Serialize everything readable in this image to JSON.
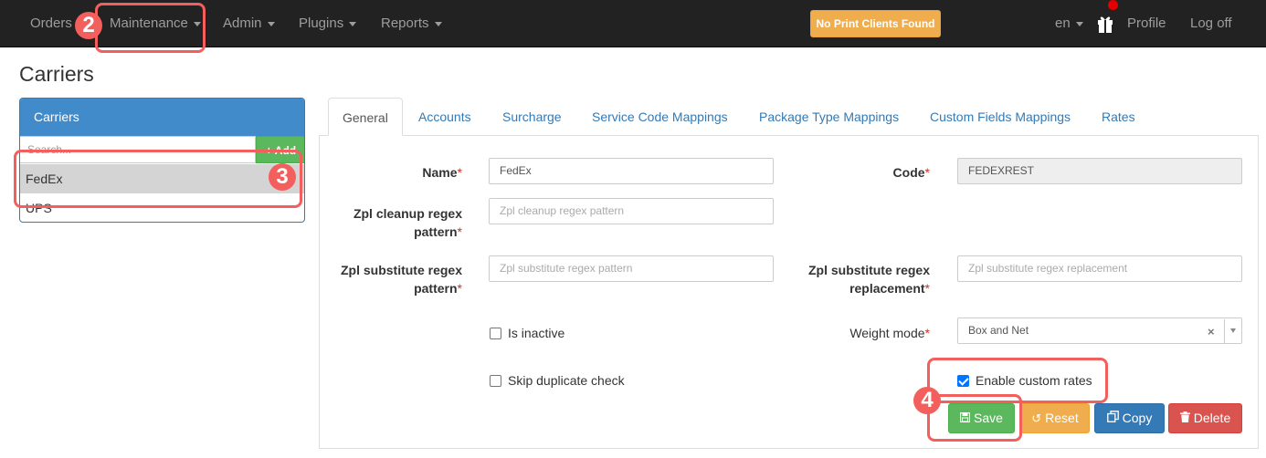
{
  "navbar": {
    "items": [
      {
        "label": "Orders",
        "dropdown": false
      },
      {
        "label": "Maintenance",
        "dropdown": true
      },
      {
        "label": "Admin",
        "dropdown": true
      },
      {
        "label": "Plugins",
        "dropdown": true
      },
      {
        "label": "Reports",
        "dropdown": true
      }
    ],
    "print_alert": "No Print Clients Found",
    "language": "en",
    "profile": "Profile",
    "logoff": "Log off"
  },
  "page": {
    "title": "Carriers"
  },
  "carriers_panel": {
    "header": "Carriers",
    "search_placeholder": "Search...",
    "add_label": "Add",
    "items": [
      {
        "name": "FedEx",
        "selected": true
      },
      {
        "name": "UPS",
        "selected": false
      }
    ]
  },
  "tabs": [
    {
      "label": "General",
      "active": true
    },
    {
      "label": "Accounts",
      "active": false
    },
    {
      "label": "Surcharge",
      "active": false
    },
    {
      "label": "Service Code Mappings",
      "active": false
    },
    {
      "label": "Package Type Mappings",
      "active": false
    },
    {
      "label": "Custom Fields Mappings",
      "active": false
    },
    {
      "label": "Rates",
      "active": false
    }
  ],
  "form": {
    "name": {
      "label": "Name",
      "value": "FedEx"
    },
    "code": {
      "label": "Code",
      "value": "FEDEXREST"
    },
    "zpl_cleanup": {
      "label_line1": "Zpl cleanup regex",
      "label_line2": "pattern",
      "placeholder": "Zpl cleanup regex pattern"
    },
    "zpl_sub_pattern": {
      "label_line1": "Zpl substitute regex",
      "label_line2": "pattern",
      "placeholder": "Zpl substitute regex pattern"
    },
    "zpl_sub_replacement": {
      "label_line1": "Zpl substitute regex",
      "label_line2": "replacement",
      "placeholder": "Zpl substitute regex replacement"
    },
    "is_inactive": {
      "label": "Is inactive",
      "checked": false
    },
    "skip_duplicate": {
      "label": "Skip duplicate check",
      "checked": false
    },
    "weight_mode": {
      "label": "Weight mode",
      "value": "Box and Net"
    },
    "enable_custom_rates": {
      "label": "Enable custom rates",
      "checked": true
    },
    "required_marker": "*"
  },
  "buttons": {
    "save": "Save",
    "reset": "Reset",
    "copy": "Copy",
    "delete": "Delete"
  },
  "annotations": {
    "step2": "2",
    "step3": "3",
    "step4": "4",
    "color": "#f25f5c"
  },
  "icons": [
    "caret-down-icon",
    "gift-icon",
    "plus-icon",
    "save-icon",
    "undo-icon",
    "copy-icon",
    "trash-icon",
    "clear-icon",
    "chevron-down-icon"
  ]
}
